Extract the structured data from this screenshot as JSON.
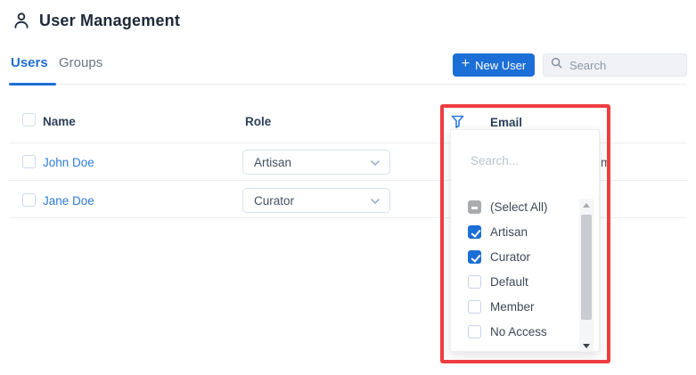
{
  "header": {
    "title": "User Management"
  },
  "tabs": {
    "users": "Users",
    "groups": "Groups"
  },
  "toolbar": {
    "plus": "+",
    "new_user": "New User",
    "search_placeholder": "Search"
  },
  "table": {
    "columns": {
      "name": "Name",
      "role": "Role",
      "email": "Email"
    },
    "rows": [
      {
        "name": "John Doe",
        "role": "Artisan",
        "email_fragment": "m"
      },
      {
        "name": "Jane Doe",
        "role": "Curator",
        "email_fragment": ""
      }
    ]
  },
  "filter_menu": {
    "search_placeholder": "Search...",
    "options": [
      {
        "label": "(Select All)",
        "state": "indeterminate"
      },
      {
        "label": "Artisan",
        "state": "checked"
      },
      {
        "label": "Curator",
        "state": "checked"
      },
      {
        "label": "Default",
        "state": "unchecked"
      },
      {
        "label": "Member",
        "state": "unchecked"
      },
      {
        "label": "No Access",
        "state": "unchecked"
      }
    ]
  },
  "colors": {
    "accent_blue": "#1c6fd6",
    "link_blue": "#2e7cd9",
    "annotation_red": "#ee3e41",
    "heading_text": "#1c2939",
    "column_header_text": "#2c405a",
    "indeterminate_gray": "#a9abad"
  }
}
